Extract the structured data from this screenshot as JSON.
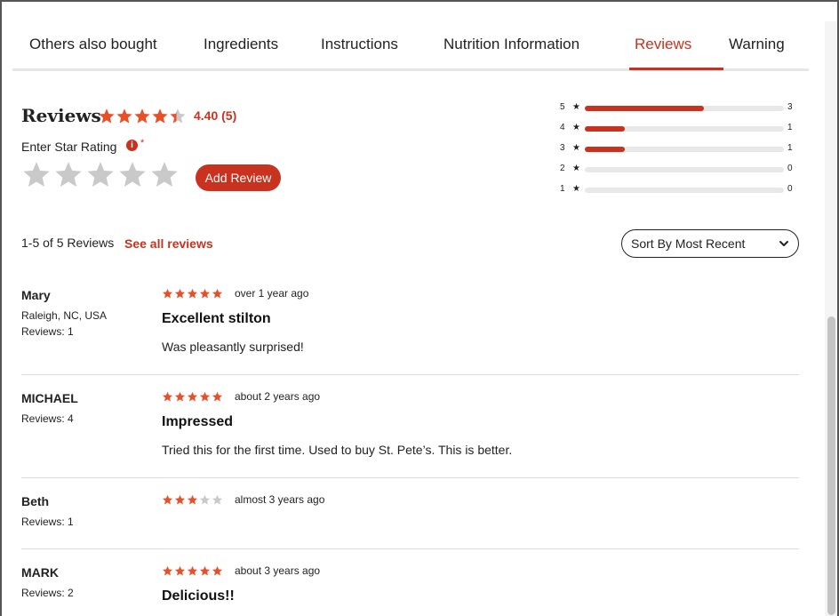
{
  "tabs": [
    {
      "label": "Others also bought",
      "active": false
    },
    {
      "label": "Ingredients",
      "active": false
    },
    {
      "label": "Instructions",
      "active": false
    },
    {
      "label": "Nutrition Information",
      "active": false
    },
    {
      "label": "Reviews",
      "active": true
    },
    {
      "label": "Warning",
      "active": false
    }
  ],
  "summary": {
    "title": "Reviews",
    "avg_rating": 4.4,
    "avg_label": "4.40 (5)",
    "enter_label": "Enter Star Rating",
    "required_mark": "*",
    "info_icon_glyph": "i",
    "add_button": "Add Review",
    "count_text": "1-5 of 5 Reviews",
    "see_all": "See all reviews",
    "sort_label": "Sort By Most Recent"
  },
  "histogram": [
    {
      "stars": "5",
      "count": "3",
      "fraction": 0.6
    },
    {
      "stars": "4",
      "count": "1",
      "fraction": 0.2
    },
    {
      "stars": "3",
      "count": "1",
      "fraction": 0.2
    },
    {
      "stars": "2",
      "count": "0",
      "fraction": 0
    },
    {
      "stars": "1",
      "count": "0",
      "fraction": 0
    }
  ],
  "reviews": [
    {
      "name": "Mary",
      "location": "Raleigh, NC, USA",
      "reviews_count": "Reviews: 1",
      "rating": 5,
      "time": "over 1 year ago",
      "title": "Excellent stilton",
      "body": "Was pleasantly surprised!"
    },
    {
      "name": "MICHAEL",
      "location": "",
      "reviews_count": "Reviews: 4",
      "rating": 5,
      "time": "about 2 years ago",
      "title": "Impressed",
      "body": "Tried this for the first time. Used to buy St. Pete’s. This is better."
    },
    {
      "name": "Beth",
      "location": "",
      "reviews_count": "Reviews: 1",
      "rating": 3,
      "time": "almost 3 years ago",
      "title": "",
      "body": ""
    },
    {
      "name": "MARK",
      "location": "",
      "reviews_count": "Reviews: 2",
      "rating": 5,
      "time": "about 3 years ago",
      "title": "Delicious!!",
      "body": ""
    }
  ],
  "colors": {
    "accent": "#c8321e",
    "star": "#e8502a",
    "star_empty": "#c9c9c9"
  },
  "icons": {
    "star": "star-icon",
    "info": "info-icon",
    "chevron": "chevron-down-icon"
  }
}
